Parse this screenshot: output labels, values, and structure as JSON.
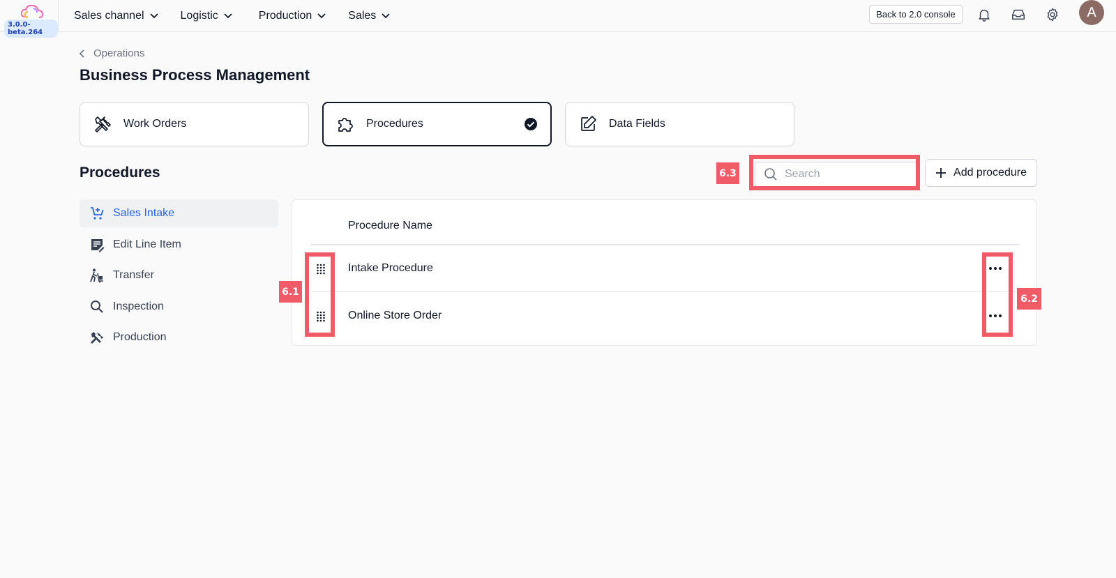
{
  "app": {
    "version": "3.0.0-beta.264"
  },
  "nav": [
    {
      "label": "Sales channel"
    },
    {
      "label": "Logistic"
    },
    {
      "label": "Production"
    },
    {
      "label": "Sales"
    }
  ],
  "header": {
    "back_label": "Back to 2.0 console",
    "avatar_letter": "A"
  },
  "breadcrumb": {
    "label": "Operations"
  },
  "page": {
    "title": "Business Process Management"
  },
  "cards": [
    {
      "label": "Work Orders",
      "icon": "tools-icon",
      "selected": false
    },
    {
      "label": "Procedures",
      "icon": "puzzle-icon",
      "selected": true
    },
    {
      "label": "Data Fields",
      "icon": "edit-icon",
      "selected": false
    }
  ],
  "section": {
    "title": "Procedures"
  },
  "search": {
    "placeholder": "Search",
    "value": ""
  },
  "add_button": {
    "label": "Add procedure"
  },
  "sidebar": {
    "items": [
      {
        "label": "Sales Intake",
        "icon": "cart-plus-icon",
        "active": true
      },
      {
        "label": "Edit Line Item",
        "icon": "edit-note-icon",
        "active": false
      },
      {
        "label": "Transfer",
        "icon": "dolly-icon",
        "active": false
      },
      {
        "label": "Inspection",
        "icon": "search-icon",
        "active": false
      },
      {
        "label": "Production",
        "icon": "tools-icon",
        "active": false
      }
    ]
  },
  "table": {
    "header": "Procedure Name",
    "rows": [
      {
        "name": "Intake Procedure"
      },
      {
        "name": "Online Store Order"
      }
    ]
  },
  "annotations": {
    "a1": "6.1",
    "a2": "6.2",
    "a3": "6.3"
  },
  "colors": {
    "accent": "#2563eb",
    "highlight": "#ef5b66",
    "avatar": "#8b6b63"
  }
}
